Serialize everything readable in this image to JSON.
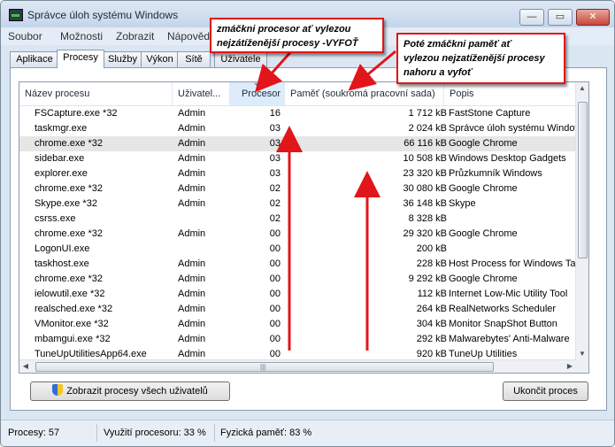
{
  "window": {
    "title": "Správce úloh systému Windows"
  },
  "menu": [
    "Soubor",
    "Možnosti",
    "Zobrazit",
    "Nápověda"
  ],
  "tabs": [
    "Aplikace",
    "Procesy",
    "Služby",
    "Výkon",
    "Sítě",
    "Uživatele"
  ],
  "active_tab": "Procesy",
  "columns": [
    "Název procesu",
    "Uživatel...",
    "Procesor",
    "Paměť (soukromá pracovní sada)",
    "Popis"
  ],
  "sorted_column": "Procesor",
  "rows": [
    [
      "FSCapture.exe *32",
      "Admin",
      "16",
      "1 712 kB",
      "FastStone Capture"
    ],
    [
      "taskmgr.exe",
      "Admin",
      "03",
      "2 024 kB",
      "Správce úloh systému Windows"
    ],
    [
      "chrome.exe *32",
      "Admin",
      "03",
      "66 116 kB",
      "Google Chrome"
    ],
    [
      "sidebar.exe",
      "Admin",
      "03",
      "10 508 kB",
      "Windows Desktop Gadgets"
    ],
    [
      "explorer.exe",
      "Admin",
      "03",
      "23 320 kB",
      "Průzkumník Windows"
    ],
    [
      "chrome.exe *32",
      "Admin",
      "02",
      "30 080 kB",
      "Google Chrome"
    ],
    [
      "Skype.exe *32",
      "Admin",
      "02",
      "36 148 kB",
      "Skype"
    ],
    [
      "csrss.exe",
      "",
      "02",
      "8 328 kB",
      ""
    ],
    [
      "chrome.exe *32",
      "Admin",
      "00",
      "29 320 kB",
      "Google Chrome"
    ],
    [
      "LogonUI.exe",
      "",
      "00",
      "200 kB",
      ""
    ],
    [
      "taskhost.exe",
      "Admin",
      "00",
      "228 kB",
      "Host Process for Windows Tasks"
    ],
    [
      "chrome.exe *32",
      "Admin",
      "00",
      "9 292 kB",
      "Google Chrome"
    ],
    [
      "ielowutil.exe *32",
      "Admin",
      "00",
      "112 kB",
      "Internet Low-Mic Utility Tool"
    ],
    [
      "realsched.exe *32",
      "Admin",
      "00",
      "264 kB",
      "RealNetworks Scheduler"
    ],
    [
      "VMonitor.exe *32",
      "Admin",
      "00",
      "304 kB",
      "Monitor SnapShot Button"
    ],
    [
      "mbamgui.exe *32",
      "Admin",
      "00",
      "292 kB",
      "Malwarebytes' Anti-Malware"
    ],
    [
      "TuneUpUtilitiesApp64.exe",
      "Admin",
      "00",
      "920 kB",
      "TuneUp Utilities"
    ]
  ],
  "selected_row": 2,
  "buttons": {
    "show_all": "Zobrazit procesy všech uživatelů",
    "end_process": "Ukončit proces"
  },
  "status": {
    "processes": "Procesy: 57",
    "cpu": "Využití procesoru: 33 %",
    "memory": "Fyzická paměť: 83 %"
  },
  "callouts": {
    "cpu": "zmáčkni procesor ať vylezou nejzátíženější procesy -VYFOŤ",
    "cpu_lines": [
      "zmáčkni procesor ať vylezou",
      "nejzátíženější procesy -VYFOŤ"
    ],
    "memory": "Poté zmáčkni paměť ať vylezou nejzatíženější procesy nahoru a vyfoť",
    "memory_lines": [
      "Poté zmáčkni paměť ať",
      "vylezou nejzatíženější procesy",
      "nahoru a vyfoť"
    ]
  },
  "colors": {
    "annotation": "#e0161b",
    "selection": "#e6e6e6",
    "sorted_header": "#dcecfb"
  },
  "icons": [
    "task-manager-icon",
    "minimize-icon",
    "maximize-icon",
    "close-icon",
    "uac-shield-icon"
  ]
}
